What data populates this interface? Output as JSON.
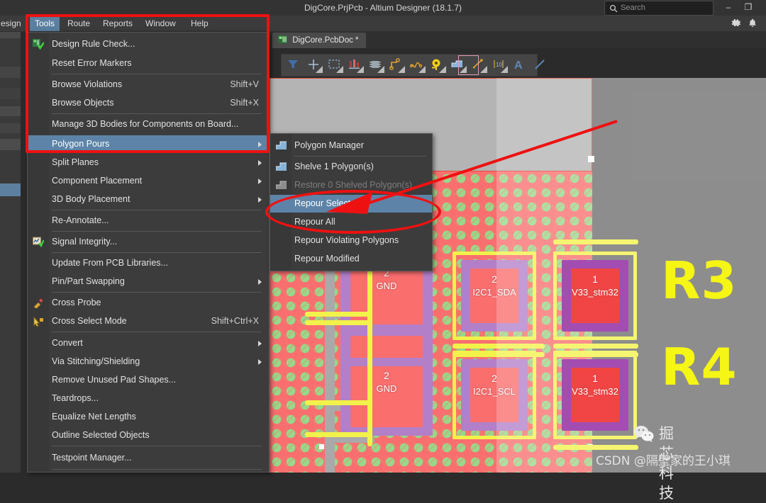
{
  "window": {
    "title": "DigCore.PrjPcb - Altium Designer (18.1.7)",
    "minimize_label": "–",
    "restore_label": "❐"
  },
  "search": {
    "placeholder": "Search",
    "value": "",
    "icon": "search-icon"
  },
  "menubar": {
    "items": [
      {
        "label": "esign",
        "accel": "",
        "active": false
      },
      {
        "label": "Tools",
        "accel": "T",
        "active": true
      },
      {
        "label": "Route",
        "accel": "u",
        "active": false
      },
      {
        "label": "Reports",
        "accel": "R",
        "active": false
      },
      {
        "label": "Window",
        "accel": "W",
        "active": false
      },
      {
        "label": "Help",
        "accel": "H",
        "active": false
      }
    ],
    "gear_icon": "gear-icon",
    "bell_icon": "bell-icon"
  },
  "document_tab": {
    "label": "DigCore.PcbDoc *",
    "icon": "pcb-document-icon"
  },
  "toolbar": {
    "icons": [
      "filter-icon",
      "crosshair-place-icon",
      "select-region-icon",
      "component-icon",
      "ic-footprint-icon",
      "route-trace-icon",
      "differential-pair-icon",
      "via-icon",
      "polygon-pour-icon",
      "dimension-icon",
      "ruler-icon",
      "text-string-icon",
      "line-icon"
    ],
    "selected_index": 8
  },
  "tools_menu": {
    "title": "Tools",
    "items": [
      {
        "label": "Design Rule Check...",
        "accel": "D",
        "shortcut": "",
        "icon": "drc-icon",
        "submenu": false,
        "state": "normal"
      },
      {
        "label": "Reset Error Markers",
        "accel": "M",
        "shortcut": "",
        "icon": "",
        "submenu": false,
        "state": "normal"
      },
      {
        "separator": true
      },
      {
        "label": "Browse Violations",
        "accel": "",
        "shortcut": "Shift+V",
        "icon": "",
        "submenu": false,
        "state": "normal"
      },
      {
        "label": "Browse Objects",
        "accel": "",
        "shortcut": "Shift+X",
        "icon": "",
        "submenu": false,
        "state": "normal"
      },
      {
        "separator": true
      },
      {
        "label": "Manage 3D Bodies for Components on Board...",
        "accel": "",
        "shortcut": "",
        "icon": "",
        "submenu": false,
        "state": "normal"
      },
      {
        "label": "Polygon Pours",
        "accel": "g",
        "shortcut": "",
        "icon": "",
        "submenu": true,
        "state": "selected"
      },
      {
        "label": "Split Planes",
        "accel": "S",
        "shortcut": "",
        "icon": "",
        "submenu": true,
        "state": "normal"
      },
      {
        "label": "Component Placement",
        "accel": "o",
        "shortcut": "",
        "icon": "",
        "submenu": true,
        "state": "normal"
      },
      {
        "label": "3D Body Placement",
        "accel": "B",
        "shortcut": "",
        "icon": "",
        "submenu": true,
        "state": "normal"
      },
      {
        "separator": true
      },
      {
        "label": "Re-Annotate...",
        "accel": "A",
        "shortcut": "",
        "icon": "",
        "submenu": false,
        "state": "normal"
      },
      {
        "separator": true
      },
      {
        "label": "Signal Integrity...",
        "accel": "y",
        "shortcut": "",
        "icon": "signal-integrity-icon",
        "submenu": false,
        "state": "normal"
      },
      {
        "separator": true
      },
      {
        "label": "Update From PCB Libraries...",
        "accel": "L",
        "shortcut": "",
        "icon": "",
        "submenu": false,
        "state": "normal"
      },
      {
        "label": "Pin/Part Swapping",
        "accel": "w",
        "shortcut": "",
        "icon": "",
        "submenu": true,
        "state": "normal"
      },
      {
        "separator": true
      },
      {
        "label": "Cross Probe",
        "accel": "C",
        "shortcut": "",
        "icon": "cross-probe-icon",
        "submenu": false,
        "state": "normal"
      },
      {
        "label": "Cross Select Mode",
        "accel": "",
        "shortcut": "Shift+Ctrl+X",
        "icon": "cross-select-icon",
        "submenu": false,
        "state": "normal"
      },
      {
        "separator": true
      },
      {
        "label": "Convert",
        "accel": "v",
        "shortcut": "",
        "icon": "",
        "submenu": true,
        "state": "normal"
      },
      {
        "label": "Via Stitching/Shielding",
        "accel": "c",
        "shortcut": "",
        "icon": "",
        "submenu": true,
        "state": "normal"
      },
      {
        "label": "Remove Unused Pad Shapes...",
        "accel": "",
        "shortcut": "",
        "icon": "",
        "submenu": false,
        "state": "normal"
      },
      {
        "label": "Teardrops...",
        "accel": "e",
        "shortcut": "",
        "icon": "",
        "submenu": false,
        "state": "normal"
      },
      {
        "label": "Equalize Net Lengths",
        "accel": "z",
        "shortcut": "",
        "icon": "",
        "submenu": false,
        "state": "normal"
      },
      {
        "label": "Outline Selected Objects",
        "accel": "",
        "shortcut": "",
        "icon": "",
        "submenu": false,
        "state": "normal"
      },
      {
        "separator": true
      },
      {
        "label": "Testpoint Manager...",
        "accel": "",
        "shortcut": "",
        "icon": "",
        "submenu": false,
        "state": "normal"
      }
    ]
  },
  "polygon_pours_submenu": {
    "items": [
      {
        "label": "Polygon Manager",
        "accel": "M",
        "icon": "polygon-icon",
        "state": "normal"
      },
      {
        "separator": true
      },
      {
        "label": "Shelve 1 Polygon(s)",
        "accel": "h",
        "icon": "polygon-icon",
        "state": "normal"
      },
      {
        "label": "Restore 0 Shelved Polygon(s)",
        "accel": "e",
        "icon": "polygon-grey-icon",
        "state": "disabled"
      },
      {
        "label": "Repour Selected",
        "accel": "R",
        "icon": "",
        "state": "selected"
      },
      {
        "label": "Repour All",
        "accel": "A",
        "icon": "",
        "state": "normal"
      },
      {
        "label": "Repour Violating Polygons",
        "accel": "V",
        "icon": "",
        "state": "normal"
      },
      {
        "label": "Repour Modified",
        "accel": "o",
        "icon": "",
        "state": "normal"
      }
    ]
  },
  "pcb": {
    "components": [
      {
        "designator": "",
        "pad": "2",
        "net": "GND"
      },
      {
        "designator": "",
        "pad": "2",
        "net": "GND"
      },
      {
        "designator": "",
        "pad": "2",
        "net": "I2C1_SDA"
      },
      {
        "designator": "",
        "pad": "2",
        "net": "I2C1_SCL"
      },
      {
        "designator": "R3",
        "pad": "1",
        "net": "V33_stm32"
      },
      {
        "designator": "R4",
        "pad": "1",
        "net": "V33_stm32"
      }
    ],
    "designators": [
      "R3",
      "R4"
    ],
    "colors": {
      "pour_fill": "#f96f6f",
      "via_green": "#96d98a",
      "trace_yellow": "#f2f24a",
      "pad_purple": "#b37fc9",
      "pad_selected_red": "#ee1111",
      "board_background": "#6e6e6e",
      "shelved_grey": "#b4b4b4"
    }
  },
  "annotations": {
    "accent_color": "#ee1111",
    "shapes": [
      "rect-around-tools-menu",
      "ellipse-around-repour",
      "arrow-to-repour-selected"
    ]
  },
  "watermark": {
    "wechat_name": "掘芯科技",
    "csdn_credit": "CSDN @隔壁家的王小琪",
    "wechat_icon": "wechat-icon"
  }
}
